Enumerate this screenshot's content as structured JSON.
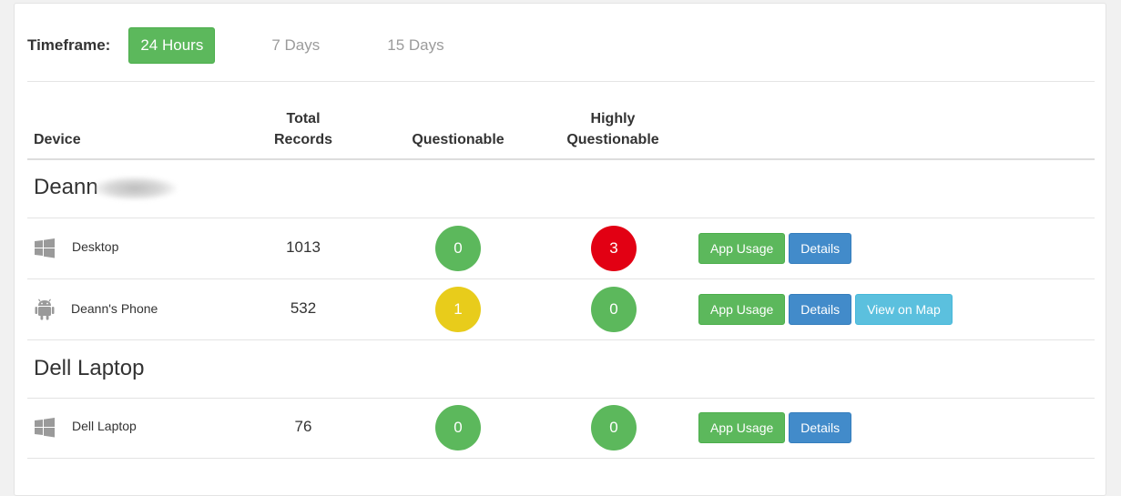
{
  "timeframe": {
    "label": "Timeframe:",
    "options": [
      "24 Hours",
      "7 Days",
      "15 Days"
    ],
    "active": "24 Hours"
  },
  "table": {
    "headers": {
      "device": "Device",
      "total": [
        "Total",
        "Records"
      ],
      "questionable": "Questionable",
      "highly": [
        "Highly",
        "Questionable"
      ]
    }
  },
  "groups": [
    {
      "title": "Deann",
      "rows": [
        {
          "icon": "windows-icon",
          "name": "Desktop",
          "total": "1013",
          "questionable": "0",
          "highly": "3",
          "buttons": [
            "App Usage",
            "Details"
          ]
        },
        {
          "icon": "android-icon",
          "name": "Deann's Phone",
          "total": "532",
          "questionable": "1",
          "highly": "0",
          "buttons": [
            "App Usage",
            "Details",
            "View on Map"
          ]
        }
      ]
    },
    {
      "title": "Dell Laptop",
      "rows": [
        {
          "icon": "windows-icon",
          "name": "Dell Laptop",
          "total": "76",
          "questionable": "0",
          "highly": "0",
          "buttons": [
            "App Usage",
            "Details"
          ]
        }
      ]
    }
  ],
  "colors": {
    "green": "#5cb85c",
    "red": "#e20013",
    "yellow": "#e8cc1b",
    "blue": "#428bca",
    "light_blue": "#5bc0de"
  }
}
